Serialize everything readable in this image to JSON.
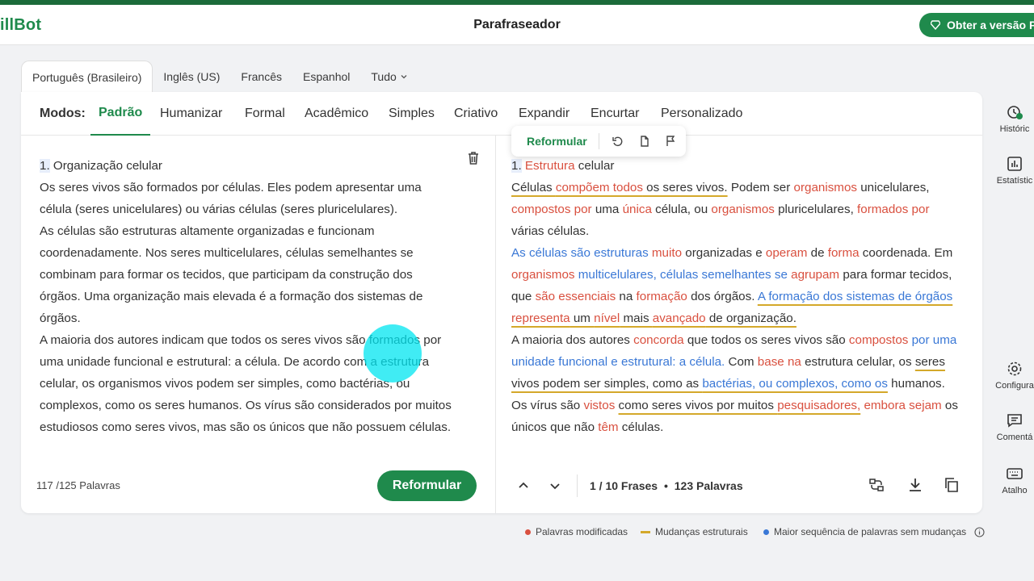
{
  "header": {
    "logo": "illBot",
    "title": "Parafraseador",
    "premium_label": "Obter a versão P"
  },
  "languages": [
    "Português (Brasileiro)",
    "Inglês (US)",
    "Francês",
    "Espanhol",
    "Tudo"
  ],
  "modes": {
    "label": "Modos:",
    "items": [
      "Padrão",
      "Humanizar",
      "Formal",
      "Acadêmico",
      "Simples",
      "Criativo",
      "Expandir",
      "Encurtar",
      "Personalizado"
    ],
    "active": "Padrão"
  },
  "input": {
    "number": "1.",
    "title": "Organização celular",
    "paragraphs": [
      "Os seres vivos são formados por células. Eles podem apresentar uma célula (seres unicelulares) ou várias células (seres pluricelulares).",
      "As células são estruturas altamente organizadas e funcionam coordenadamente. Nos seres multicelulares, células semelhantes se combinam para formar os tecidos, que participam da construção dos órgãos. Uma organização mais elevada é a formação dos sistemas de órgãos.",
      "A maioria dos autores indicam que todos os seres vivos são formados por uma unidade funcional e estrutural: a célula. De acordo com a estrutura celular, os organismos vivos podem ser simples, como bactérias, ou complexos, como os seres humanos. Os vírus são considerados por muitos estudiosos como seres vivos, mas são os únicos que não possuem células."
    ],
    "word_count": "117 /125 Palavras",
    "rephrase_button": "Reformular"
  },
  "output": {
    "number": "1.",
    "toolbar_label": "Reformular",
    "segments": [
      {
        "t": "1.",
        "c": "num"
      },
      {
        "t": " "
      },
      {
        "t": "Estrutura",
        "c": "chg"
      },
      {
        "t": " celular"
      },
      {
        "br": true
      },
      {
        "t": "Células ",
        "c": "str"
      },
      {
        "t": "compõem todos",
        "c": "chg str"
      },
      {
        "t": " os seres vivos.",
        "c": "str"
      },
      {
        "t": " Podem ser "
      },
      {
        "t": "organismos",
        "c": "chg"
      },
      {
        "t": " unicelulares, "
      },
      {
        "t": "compostos por",
        "c": "chg"
      },
      {
        "t": " uma "
      },
      {
        "t": "única",
        "c": "chg"
      },
      {
        "t": " célula, ou "
      },
      {
        "t": "organismos",
        "c": "chg"
      },
      {
        "t": " pluricelulares, "
      },
      {
        "t": "formados por",
        "c": "chg"
      },
      {
        "t": " várias células."
      },
      {
        "br": true
      },
      {
        "t": "As células são estruturas ",
        "c": "seq"
      },
      {
        "t": "muito",
        "c": "chg"
      },
      {
        "t": " organizadas e "
      },
      {
        "t": "operam",
        "c": "chg"
      },
      {
        "t": " de "
      },
      {
        "t": "forma",
        "c": "chg"
      },
      {
        "t": " coordenada. Em "
      },
      {
        "t": "organismos",
        "c": "chg"
      },
      {
        "t": " "
      },
      {
        "t": "multicelulares, células semelhantes se",
        "c": "seq"
      },
      {
        "t": " "
      },
      {
        "t": "agrupam",
        "c": "chg"
      },
      {
        "t": " para formar tecidos, que "
      },
      {
        "t": "são essenciais",
        "c": "chg"
      },
      {
        "t": " na "
      },
      {
        "t": "formação",
        "c": "chg"
      },
      {
        "t": " dos órgãos. "
      },
      {
        "t": "A formação dos sistemas de órgãos",
        "c": "seq str"
      },
      {
        "t": " ",
        "c": "str"
      },
      {
        "t": "representa",
        "c": "chg str"
      },
      {
        "t": " um ",
        "c": "str"
      },
      {
        "t": "nível",
        "c": "chg str"
      },
      {
        "t": " mais ",
        "c": "str"
      },
      {
        "t": "avançado",
        "c": "chg str"
      },
      {
        "t": " de organização.",
        "c": "str"
      },
      {
        "br": true
      },
      {
        "t": "A maioria dos autores "
      },
      {
        "t": "concorda",
        "c": "chg"
      },
      {
        "t": " que todos os seres vivos são "
      },
      {
        "t": "compostos",
        "c": "chg"
      },
      {
        "t": " "
      },
      {
        "t": "por uma unidade funcional e estrutural: a célula.",
        "c": "seq"
      },
      {
        "t": " Com "
      },
      {
        "t": "base na",
        "c": "chg"
      },
      {
        "t": " estrutura celular, os "
      },
      {
        "t": "seres vivos podem ser simples, como as ",
        "c": "str"
      },
      {
        "t": "bactérias, ou complexos, como os",
        "c": "seq str"
      },
      {
        "t": " humanos. Os vírus são "
      },
      {
        "t": "vistos",
        "c": "chg"
      },
      {
        "t": " "
      },
      {
        "t": "como seres vivos por muitos ",
        "c": "str"
      },
      {
        "t": "pesquisadores,",
        "c": "chg str"
      },
      {
        "t": " "
      },
      {
        "t": "embora sejam",
        "c": "chg"
      },
      {
        "t": " os únicos que não "
      },
      {
        "t": "têm",
        "c": "chg"
      },
      {
        "t": " células."
      }
    ],
    "sentences": "1 / 10 Frases",
    "bullet": "•",
    "word_count": "123 Palavras"
  },
  "legend": {
    "modified": "Palavras modificadas",
    "structural": "Mudanças estruturais",
    "longest": "Maior sequência de palavras sem mudanças",
    "colors": {
      "modified": "#d9503f",
      "structural": "#d4a82a",
      "longest": "#3a78d6"
    }
  },
  "sidebar": {
    "items": [
      "Históric",
      "Estatístic",
      "Configura",
      "Comentá",
      "Atalho"
    ]
  },
  "colors": {
    "brand": "#1f8a4c",
    "accent_bar": "#1b6b3a"
  }
}
